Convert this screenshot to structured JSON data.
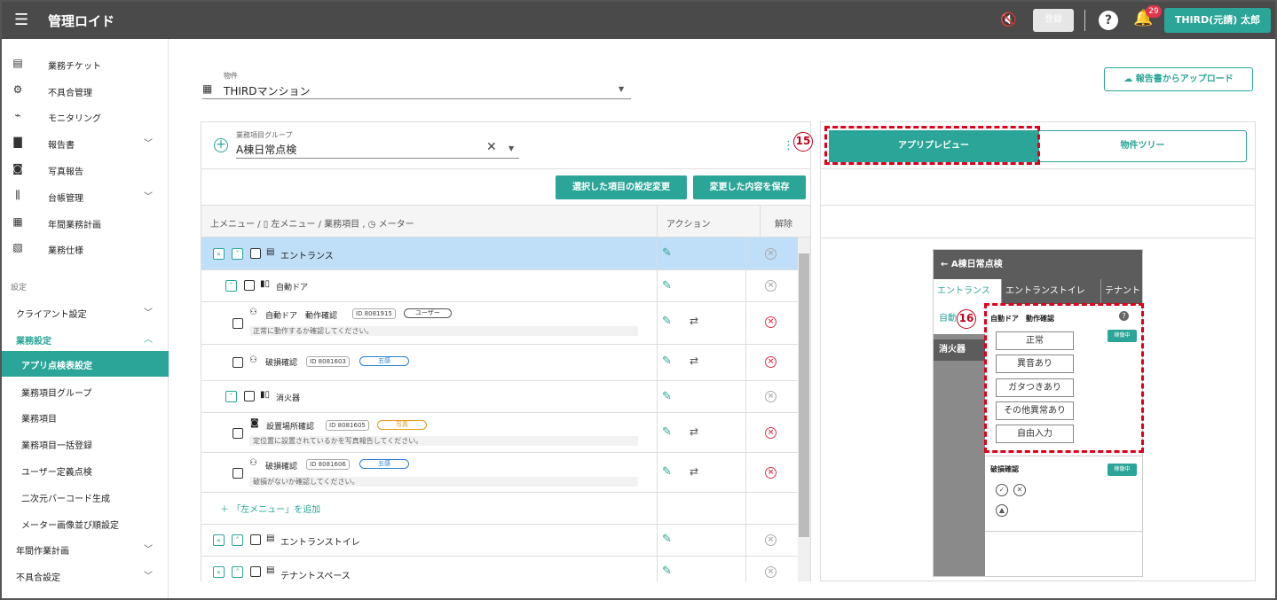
{
  "topbar": {
    "app_title": "管理ロイド",
    "graybtn": "登録",
    "help": "?",
    "notif_count": "29",
    "user": "THIRD(元請) 太郎"
  },
  "sidebar": {
    "items": [
      {
        "label": "業務チケット",
        "icon": "▤"
      },
      {
        "label": "不具合管理",
        "icon": "⚙"
      },
      {
        "label": "モニタリング",
        "icon": "⌁"
      },
      {
        "label": "報告書",
        "icon": "▇"
      },
      {
        "label": "写真報告",
        "icon": "◙"
      },
      {
        "label": "台帳管理",
        "icon": "⫼"
      },
      {
        "label": "年間業務計画",
        "icon": "▦"
      },
      {
        "label": "業務仕様",
        "icon": "▧"
      }
    ],
    "section": "設定",
    "settings": [
      {
        "label": "クライアント設定"
      },
      {
        "label": "業務設定"
      },
      {
        "label": "アプリ点検表設定"
      },
      {
        "label": "業務項目グループ"
      },
      {
        "label": "業務項目"
      },
      {
        "label": "業務項目一括登録"
      },
      {
        "label": "ユーザー定義点検"
      },
      {
        "label": "二次元バーコード生成"
      },
      {
        "label": "メーター画像並び順設定"
      },
      {
        "label": "年間作業計画"
      },
      {
        "label": "不具合設定"
      }
    ]
  },
  "property": {
    "label": "物件",
    "value": "THIRDマンション"
  },
  "upload_button": "報告書からアップロード",
  "group": {
    "label": "業務項目グループ",
    "value": "A棟日常点検"
  },
  "buttons": {
    "change_settings": "選択した項目の設定変更",
    "save_changes": "変更した内容を保存"
  },
  "table": {
    "col1": "上メニュー / ▯ 左メニュー / 業務項目 , ◷ メーター",
    "col2": "アクション",
    "col3": "解除",
    "rows": [
      {
        "label": "エントランス"
      },
      {
        "label": "自動ドア"
      },
      {
        "label": "自動ドア　動作確認",
        "id": "ID 8081915",
        "tag": "ユーザー",
        "desc": "正常に動作するか確認してください。"
      },
      {
        "label": "破損確認",
        "id": "ID 8081603",
        "tag": "五感"
      },
      {
        "label": "消火器"
      },
      {
        "label": "設置場所確認",
        "id": "ID 8081605",
        "tag": "写真",
        "desc": "定位置に設置されているかを写真報告してください。"
      },
      {
        "label": "破損確認",
        "id": "ID 8081606",
        "tag": "五感",
        "desc": "破損がないか確認してください。"
      },
      {
        "label": "「左メニュー」を追加"
      },
      {
        "label": "エントランストイレ"
      },
      {
        "label": "テナントスペース"
      }
    ]
  },
  "tabs": {
    "preview": "アプリプレビュー",
    "tree": "物件ツリー"
  },
  "callouts": {
    "c15": "15",
    "c16": "16"
  },
  "preview": {
    "header": "← A棟日常点検",
    "tabs": [
      "エントランス",
      "エントランストイレ",
      "テナント"
    ],
    "side": [
      "自動",
      "消火器"
    ],
    "q1": "自動ドア　動作確認",
    "badge": "稼働中",
    "options": [
      "正常",
      "異音あり",
      "ガタつきあり",
      "その他異常あり",
      "自由入力"
    ],
    "q2": "破損確認"
  },
  "colors": {
    "accent": "#2aa597",
    "danger": "#e0344b",
    "topbar": "#4a4a4a"
  }
}
